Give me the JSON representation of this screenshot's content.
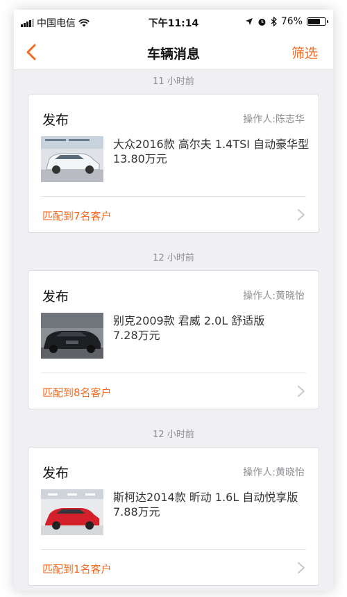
{
  "status_bar": {
    "carrier": "中国电信",
    "time": "下午11:14",
    "battery": "76%",
    "battery_level": 0.76
  },
  "navbar": {
    "title": "车辆消息",
    "filter": "筛选"
  },
  "feed": [
    {
      "time": "11 小时前",
      "type": "发布",
      "operator": "操作人:陈志华",
      "car_name": "大众2016款 高尔夫 1.4TSI 自动豪华型",
      "price": "13.80万元",
      "match": "匹配到7名客户"
    },
    {
      "time": "12 小时前",
      "type": "发布",
      "operator": "操作人:黄晓怡",
      "car_name": "别克2009款  君威  2.0L 舒适版",
      "price": "7.28万元",
      "match": "匹配到8名客户"
    },
    {
      "time": "12 小时前",
      "type": "发布",
      "operator": "操作人:黄晓怡",
      "car_name": "斯柯达2014款  昕动  1.6L 自动悦享版",
      "price": "7.88万元",
      "match": "匹配到1名客户"
    }
  ],
  "colors": {
    "accent": "#f26b21",
    "background": "#efeff4",
    "muted": "#8e8e93"
  },
  "icons": {
    "back": "chevron-left-icon",
    "arrow": "chevron-right-icon",
    "wifi": "wifi-icon",
    "location": "location-arrow-icon",
    "alarm": "alarm-icon",
    "bluetooth": "bluetooth-icon"
  }
}
